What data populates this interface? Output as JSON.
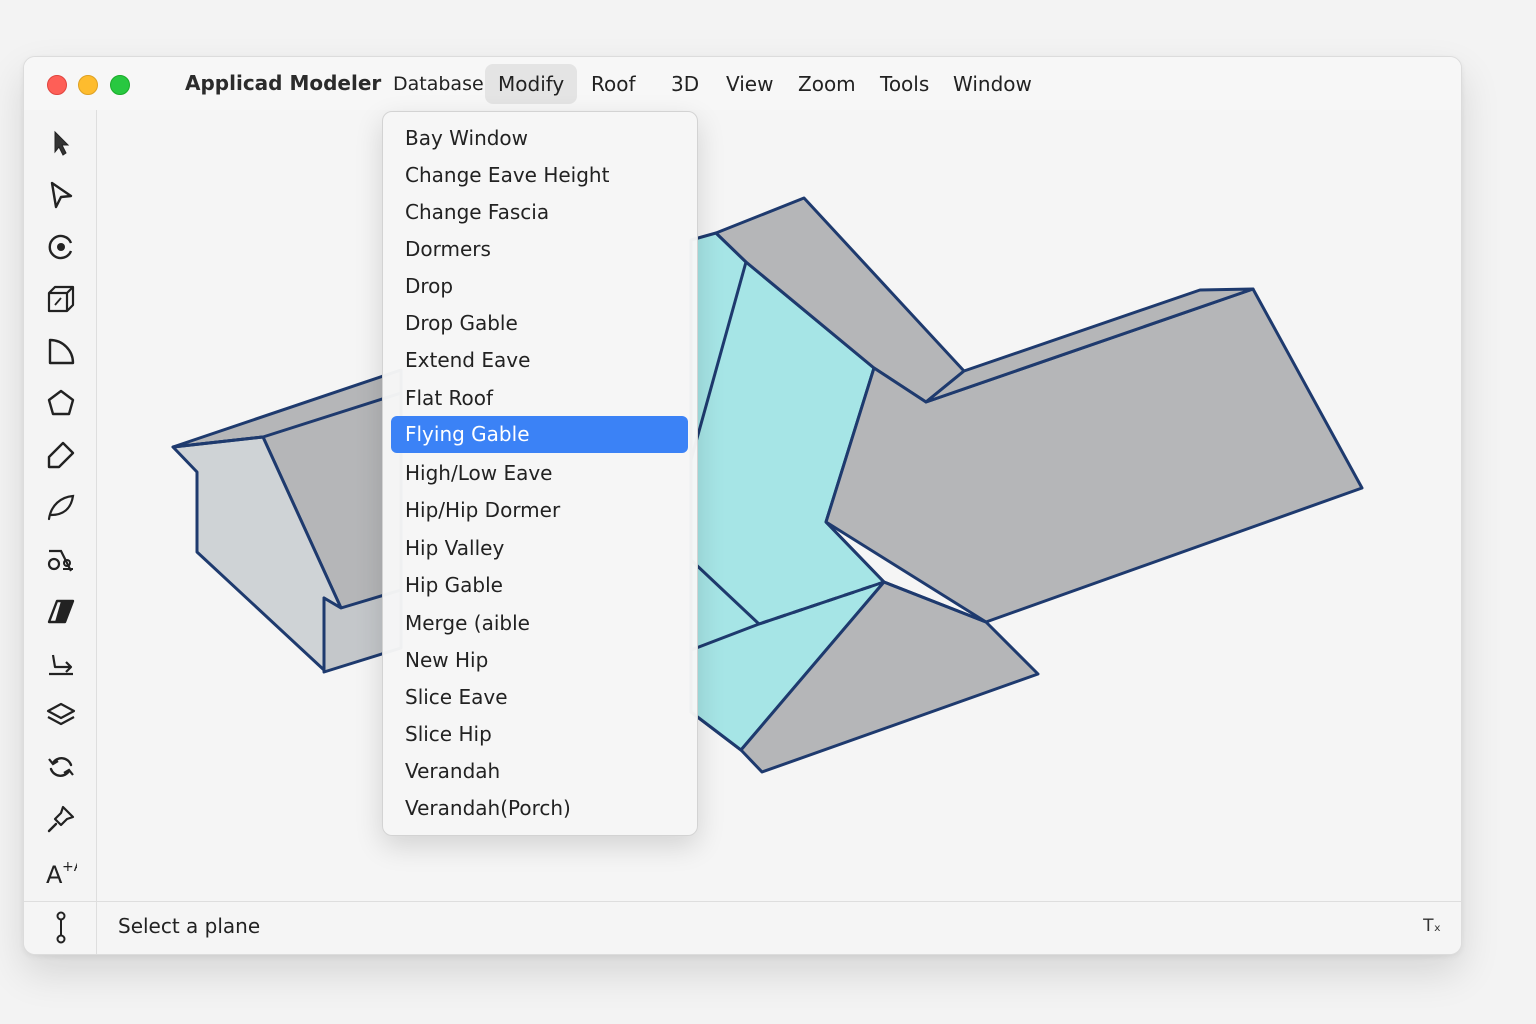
{
  "app": {
    "title": "Applicad Modeler"
  },
  "menubar": {
    "items": [
      {
        "label": "Database",
        "active": false
      },
      {
        "label": "Modify",
        "active": true
      },
      {
        "label": "Roof",
        "active": false
      },
      {
        "label": "3D",
        "active": false
      },
      {
        "label": "View",
        "active": false
      },
      {
        "label": "Zoom",
        "active": false
      },
      {
        "label": "Tools",
        "active": false
      },
      {
        "label": "Window",
        "active": false
      }
    ]
  },
  "modify_menu": {
    "items": [
      "Bay Window",
      "Change Eave Height",
      "Change Fascia",
      "Dormers",
      "Drop",
      "Drop Gable",
      "Extend Eave",
      "Flat Roof",
      "Flying Gable",
      "High/Low Eave",
      "Hip/Hip Dormer",
      "Hip Valley",
      "Hip Gable",
      "Merge (aible",
      "New Hip",
      "Slice Eave",
      "Slice Hip",
      "Verandah",
      "Verandah(Porch)"
    ],
    "selected": "Flying Gable"
  },
  "toolbar": {
    "tools": [
      "select-arrow-icon",
      "pointer-icon",
      "orbit-icon",
      "cube-icon",
      "quarter-round-icon",
      "pentagon-icon",
      "pencil-shape-icon",
      "leaf-curve-icon",
      "snap-tool-icon",
      "prism-icon",
      "arrow-on-line-icon",
      "layers-icon",
      "rotate-arrows-icon",
      "pin-icon",
      "text-size-icon"
    ],
    "bottom_tool": "measure-icon"
  },
  "statusbar": {
    "message": "Select a plane",
    "right_indicator": "Tₓ"
  },
  "colors": {
    "roof_grey": "#b5b6b8",
    "roof_light": "#cfd3d6",
    "selected_plane": "#a6e5e6",
    "outline": "#1e3a6e",
    "menu_highlight": "#3b82f6"
  }
}
